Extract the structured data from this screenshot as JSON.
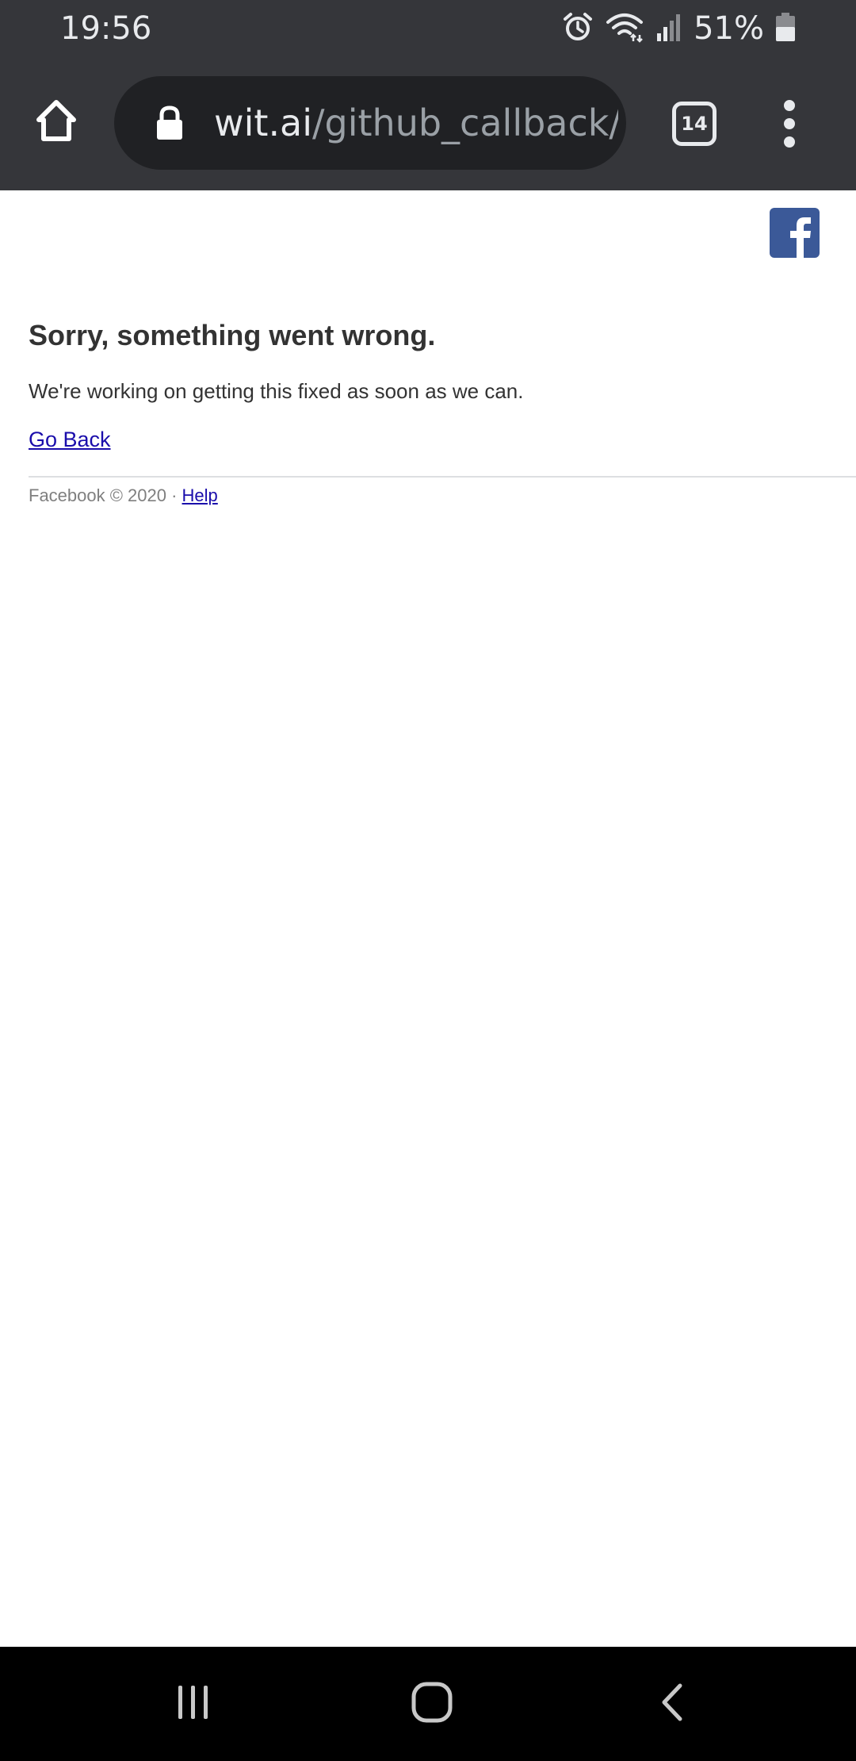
{
  "status_bar": {
    "time": "19:56",
    "battery_percent": "51%",
    "icons": [
      "alarm-icon",
      "wifi-icon",
      "signal-icon",
      "battery-icon"
    ]
  },
  "browser": {
    "url_host": "wit.ai",
    "url_path": "/github_callback/",
    "tab_count": "14",
    "icons": [
      "home-icon",
      "lock-icon",
      "tab-switcher-icon",
      "overflow-menu-icon"
    ]
  },
  "page": {
    "logo": "facebook-logo-icon",
    "title": "Sorry, something went wrong.",
    "message": "We're working on getting this fixed as soon as we can.",
    "go_back_label": "Go Back",
    "footer_text": "Facebook © 2020 · ",
    "help_label": "Help"
  },
  "nav_bar": {
    "icons": [
      "recent-apps-icon",
      "home-nav-icon",
      "back-icon"
    ]
  },
  "colors": {
    "browser_chrome": "#35363a",
    "omnibox": "#202124",
    "facebook_blue": "#3b5998",
    "link": "#1a0dab",
    "text": "#333333"
  }
}
